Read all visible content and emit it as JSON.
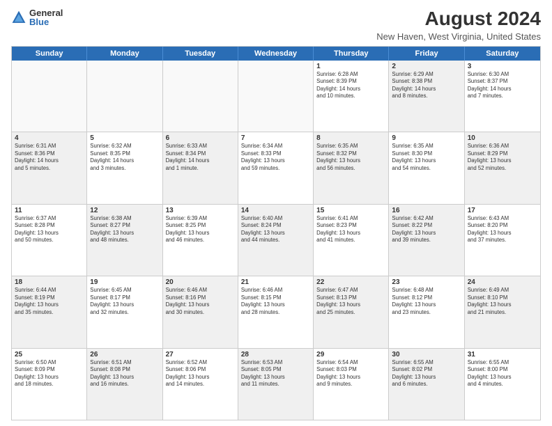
{
  "logo": {
    "general": "General",
    "blue": "Blue"
  },
  "title": "August 2024",
  "subtitle": "New Haven, West Virginia, United States",
  "days": [
    "Sunday",
    "Monday",
    "Tuesday",
    "Wednesday",
    "Thursday",
    "Friday",
    "Saturday"
  ],
  "rows": [
    [
      {
        "num": "",
        "info": "",
        "empty": true
      },
      {
        "num": "",
        "info": "",
        "empty": true
      },
      {
        "num": "",
        "info": "",
        "empty": true
      },
      {
        "num": "",
        "info": "",
        "empty": true
      },
      {
        "num": "1",
        "info": "Sunrise: 6:28 AM\nSunset: 8:39 PM\nDaylight: 14 hours\nand 10 minutes.",
        "empty": false
      },
      {
        "num": "2",
        "info": "Sunrise: 6:29 AM\nSunset: 8:38 PM\nDaylight: 14 hours\nand 8 minutes.",
        "empty": false,
        "shaded": true
      },
      {
        "num": "3",
        "info": "Sunrise: 6:30 AM\nSunset: 8:37 PM\nDaylight: 14 hours\nand 7 minutes.",
        "empty": false
      }
    ],
    [
      {
        "num": "4",
        "info": "Sunrise: 6:31 AM\nSunset: 8:36 PM\nDaylight: 14 hours\nand 5 minutes.",
        "empty": false,
        "shaded": true
      },
      {
        "num": "5",
        "info": "Sunrise: 6:32 AM\nSunset: 8:35 PM\nDaylight: 14 hours\nand 3 minutes.",
        "empty": false
      },
      {
        "num": "6",
        "info": "Sunrise: 6:33 AM\nSunset: 8:34 PM\nDaylight: 14 hours\nand 1 minute.",
        "empty": false,
        "shaded": true
      },
      {
        "num": "7",
        "info": "Sunrise: 6:34 AM\nSunset: 8:33 PM\nDaylight: 13 hours\nand 59 minutes.",
        "empty": false
      },
      {
        "num": "8",
        "info": "Sunrise: 6:35 AM\nSunset: 8:32 PM\nDaylight: 13 hours\nand 56 minutes.",
        "empty": false,
        "shaded": true
      },
      {
        "num": "9",
        "info": "Sunrise: 6:35 AM\nSunset: 8:30 PM\nDaylight: 13 hours\nand 54 minutes.",
        "empty": false
      },
      {
        "num": "10",
        "info": "Sunrise: 6:36 AM\nSunset: 8:29 PM\nDaylight: 13 hours\nand 52 minutes.",
        "empty": false,
        "shaded": true
      }
    ],
    [
      {
        "num": "11",
        "info": "Sunrise: 6:37 AM\nSunset: 8:28 PM\nDaylight: 13 hours\nand 50 minutes.",
        "empty": false
      },
      {
        "num": "12",
        "info": "Sunrise: 6:38 AM\nSunset: 8:27 PM\nDaylight: 13 hours\nand 48 minutes.",
        "empty": false,
        "shaded": true
      },
      {
        "num": "13",
        "info": "Sunrise: 6:39 AM\nSunset: 8:25 PM\nDaylight: 13 hours\nand 46 minutes.",
        "empty": false
      },
      {
        "num": "14",
        "info": "Sunrise: 6:40 AM\nSunset: 8:24 PM\nDaylight: 13 hours\nand 44 minutes.",
        "empty": false,
        "shaded": true
      },
      {
        "num": "15",
        "info": "Sunrise: 6:41 AM\nSunset: 8:23 PM\nDaylight: 13 hours\nand 41 minutes.",
        "empty": false
      },
      {
        "num": "16",
        "info": "Sunrise: 6:42 AM\nSunset: 8:22 PM\nDaylight: 13 hours\nand 39 minutes.",
        "empty": false,
        "shaded": true
      },
      {
        "num": "17",
        "info": "Sunrise: 6:43 AM\nSunset: 8:20 PM\nDaylight: 13 hours\nand 37 minutes.",
        "empty": false
      }
    ],
    [
      {
        "num": "18",
        "info": "Sunrise: 6:44 AM\nSunset: 8:19 PM\nDaylight: 13 hours\nand 35 minutes.",
        "empty": false,
        "shaded": true
      },
      {
        "num": "19",
        "info": "Sunrise: 6:45 AM\nSunset: 8:17 PM\nDaylight: 13 hours\nand 32 minutes.",
        "empty": false
      },
      {
        "num": "20",
        "info": "Sunrise: 6:46 AM\nSunset: 8:16 PM\nDaylight: 13 hours\nand 30 minutes.",
        "empty": false,
        "shaded": true
      },
      {
        "num": "21",
        "info": "Sunrise: 6:46 AM\nSunset: 8:15 PM\nDaylight: 13 hours\nand 28 minutes.",
        "empty": false
      },
      {
        "num": "22",
        "info": "Sunrise: 6:47 AM\nSunset: 8:13 PM\nDaylight: 13 hours\nand 25 minutes.",
        "empty": false,
        "shaded": true
      },
      {
        "num": "23",
        "info": "Sunrise: 6:48 AM\nSunset: 8:12 PM\nDaylight: 13 hours\nand 23 minutes.",
        "empty": false
      },
      {
        "num": "24",
        "info": "Sunrise: 6:49 AM\nSunset: 8:10 PM\nDaylight: 13 hours\nand 21 minutes.",
        "empty": false,
        "shaded": true
      }
    ],
    [
      {
        "num": "25",
        "info": "Sunrise: 6:50 AM\nSunset: 8:09 PM\nDaylight: 13 hours\nand 18 minutes.",
        "empty": false
      },
      {
        "num": "26",
        "info": "Sunrise: 6:51 AM\nSunset: 8:08 PM\nDaylight: 13 hours\nand 16 minutes.",
        "empty": false,
        "shaded": true
      },
      {
        "num": "27",
        "info": "Sunrise: 6:52 AM\nSunset: 8:06 PM\nDaylight: 13 hours\nand 14 minutes.",
        "empty": false
      },
      {
        "num": "28",
        "info": "Sunrise: 6:53 AM\nSunset: 8:05 PM\nDaylight: 13 hours\nand 11 minutes.",
        "empty": false,
        "shaded": true
      },
      {
        "num": "29",
        "info": "Sunrise: 6:54 AM\nSunset: 8:03 PM\nDaylight: 13 hours\nand 9 minutes.",
        "empty": false
      },
      {
        "num": "30",
        "info": "Sunrise: 6:55 AM\nSunset: 8:02 PM\nDaylight: 13 hours\nand 6 minutes.",
        "empty": false,
        "shaded": true
      },
      {
        "num": "31",
        "info": "Sunrise: 6:55 AM\nSunset: 8:00 PM\nDaylight: 13 hours\nand 4 minutes.",
        "empty": false
      }
    ]
  ]
}
